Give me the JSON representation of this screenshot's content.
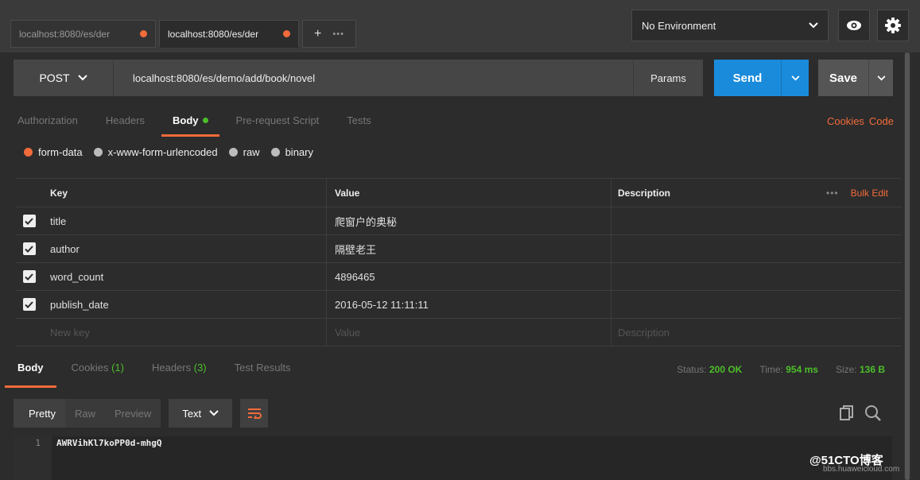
{
  "tabs": [
    {
      "label": "localhost:8080/es/der",
      "active": false
    },
    {
      "label": "localhost:8080/es/der",
      "active": true
    }
  ],
  "tab_add": "+",
  "tab_more": "•••",
  "environment": {
    "selected": "No Environment"
  },
  "request": {
    "method": "POST",
    "url": "localhost:8080/es/demo/add/book/novel",
    "params_label": "Params",
    "send_label": "Send",
    "save_label": "Save"
  },
  "request_tabs": [
    "Authorization",
    "Headers",
    "Body",
    "Pre-request Script",
    "Tests"
  ],
  "links": {
    "cookies": "Cookies",
    "code": "Code"
  },
  "body_types": [
    "form-data",
    "x-www-form-urlencoded",
    "raw",
    "binary"
  ],
  "table": {
    "headers": {
      "key": "Key",
      "value": "Value",
      "description": "Description"
    },
    "more": "•••",
    "bulk_edit": "Bulk Edit",
    "rows": [
      {
        "key": "title",
        "value": "爬窗户的奥秘"
      },
      {
        "key": "author",
        "value": "隔壁老王"
      },
      {
        "key": "word_count",
        "value": "4896465"
      },
      {
        "key": "publish_date",
        "value": "2016-05-12 11:11:11"
      }
    ],
    "placeholders": {
      "key": "New key",
      "value": "Value",
      "description": "Description"
    }
  },
  "response_tabs": {
    "body": "Body",
    "cookies": "Cookies",
    "cookies_count": "(1)",
    "headers": "Headers",
    "headers_count": "(3)",
    "tests": "Test Results"
  },
  "status": {
    "status_label": "Status:",
    "status_value": "200 OK",
    "time_label": "Time:",
    "time_value": "954 ms",
    "size_label": "Size:",
    "size_value": "136 B"
  },
  "view_modes": [
    "Pretty",
    "Raw",
    "Preview"
  ],
  "format": "Text",
  "response_body": {
    "line": "1",
    "content": "AWRVihKl7koPP0d-mhgQ"
  },
  "watermark": {
    "main": "@51CTO博客",
    "sub": "bbs.huaweicloud.com"
  },
  "colors": {
    "accent": "#f26b3a",
    "send": "#1a8bdb",
    "success": "#4cbe2a"
  }
}
